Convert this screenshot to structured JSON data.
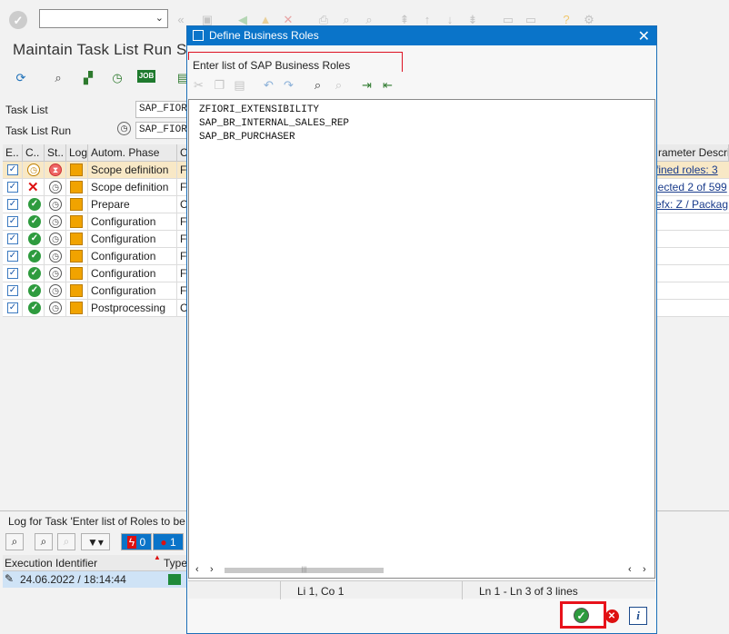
{
  "main": {
    "title": "Maintain Task List Run SA",
    "task_list_label": "Task List",
    "task_list_value": "SAP_FIOR",
    "task_list_run_label": "Task List Run",
    "task_list_run_value": "SAP_FIOR"
  },
  "table": {
    "headers": [
      "E..",
      "C..",
      "St..",
      "Log",
      "Autom. Phase",
      "C",
      "rameter Descri"
    ],
    "rows": [
      {
        "phase": "Scope definition",
        "c": "FI",
        "param": "fined roles: 3"
      },
      {
        "phase": "Scope definition",
        "c": "FI",
        "param": "lected 2 of 599"
      },
      {
        "phase": "Prepare",
        "c": "CT",
        "param": "efx: Z / Packag"
      },
      {
        "phase": "Configuration",
        "c": "FI",
        "param": ""
      },
      {
        "phase": "Configuration",
        "c": "FI",
        "param": ""
      },
      {
        "phase": "Configuration",
        "c": "FI",
        "param": ""
      },
      {
        "phase": "Configuration",
        "c": "FI",
        "param": ""
      },
      {
        "phase": "Configuration",
        "c": "FI",
        "param": ""
      },
      {
        "phase": "Postprocessing",
        "c": "CT",
        "param": ""
      }
    ]
  },
  "log": {
    "title": "Log for Task 'Enter list of Roles to be",
    "count_error": "0",
    "count_stop": "1",
    "col_exec": "Execution Identifier",
    "col_type": "Type",
    "exec_value": "24.06.2022 / 18:14:44"
  },
  "dialog": {
    "title": "Define Business Roles",
    "prompt": "Enter list of SAP Business Roles",
    "lines": [
      "ZFIORI_EXTENSIBILITY",
      "SAP_BR_INTERNAL_SALES_REP",
      "SAP_BR_PURCHASER"
    ],
    "status_pos": "Li 1, Co 1",
    "status_lines": "Ln 1 - Ln 3 of 3 lines"
  },
  "colors": {
    "dialog_header": "#0a74c9",
    "highlight": "#e8121b",
    "ok_green": "#2e9b3e"
  }
}
